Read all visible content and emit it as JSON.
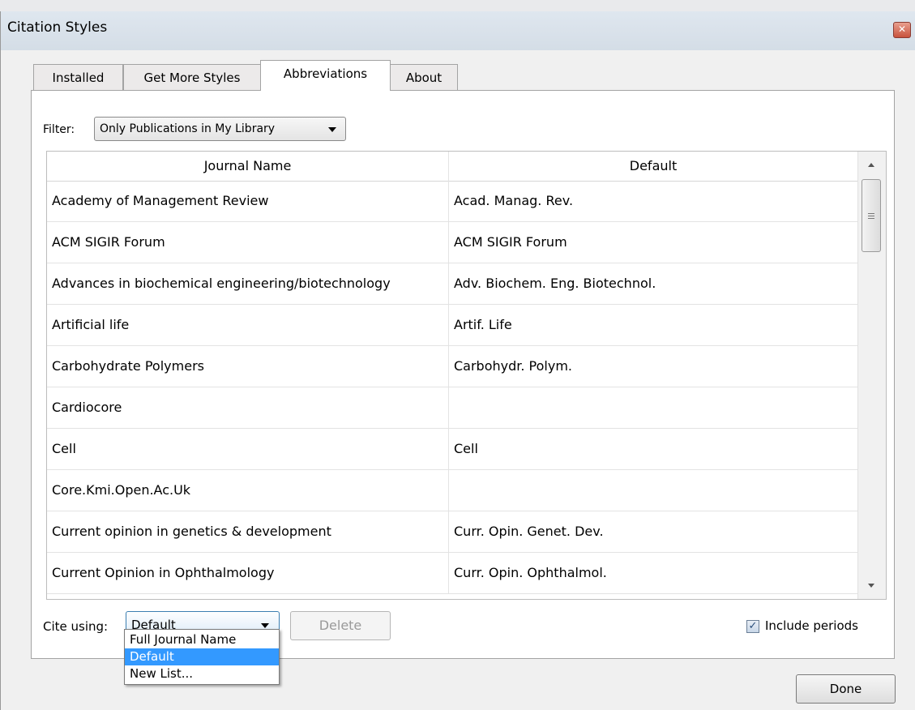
{
  "window": {
    "title": "Citation Styles"
  },
  "tabs": [
    {
      "label": "Installed"
    },
    {
      "label": "Get More Styles"
    },
    {
      "label": "Abbreviations"
    },
    {
      "label": "About"
    }
  ],
  "filter": {
    "label": "Filter:",
    "value": "Only Publications in My Library"
  },
  "table": {
    "headers": [
      "Journal Name",
      "Default"
    ],
    "rows": [
      [
        "Academy of Management Review",
        "Acad. Manag. Rev."
      ],
      [
        "ACM SIGIR Forum",
        "ACM SIGIR Forum"
      ],
      [
        "Advances in biochemical engineering/biotechnology",
        "Adv. Biochem. Eng. Biotechnol."
      ],
      [
        "Artificial life",
        "Artif. Life"
      ],
      [
        "Carbohydrate Polymers",
        "Carbohydr. Polym."
      ],
      [
        "Cardiocore",
        ""
      ],
      [
        "Cell",
        "Cell"
      ],
      [
        "Core.Kmi.Open.Ac.Uk",
        ""
      ],
      [
        "Current opinion in genetics & development",
        "Curr. Opin. Genet. Dev."
      ],
      [
        "Current Opinion in Ophthalmology",
        "Curr. Opin. Ophthalmol."
      ]
    ]
  },
  "cite": {
    "label": "Cite using:",
    "value": "Default",
    "options": [
      "Full Journal Name",
      "Default",
      "New List..."
    ],
    "selected_option": "Default"
  },
  "buttons": {
    "delete": "Delete",
    "done": "Done"
  },
  "include_periods": {
    "label": "Include periods",
    "checked": true
  },
  "colors": {
    "selection": "#3399ff",
    "panel": "#ffffff",
    "dialog": "#f0f0f0"
  }
}
